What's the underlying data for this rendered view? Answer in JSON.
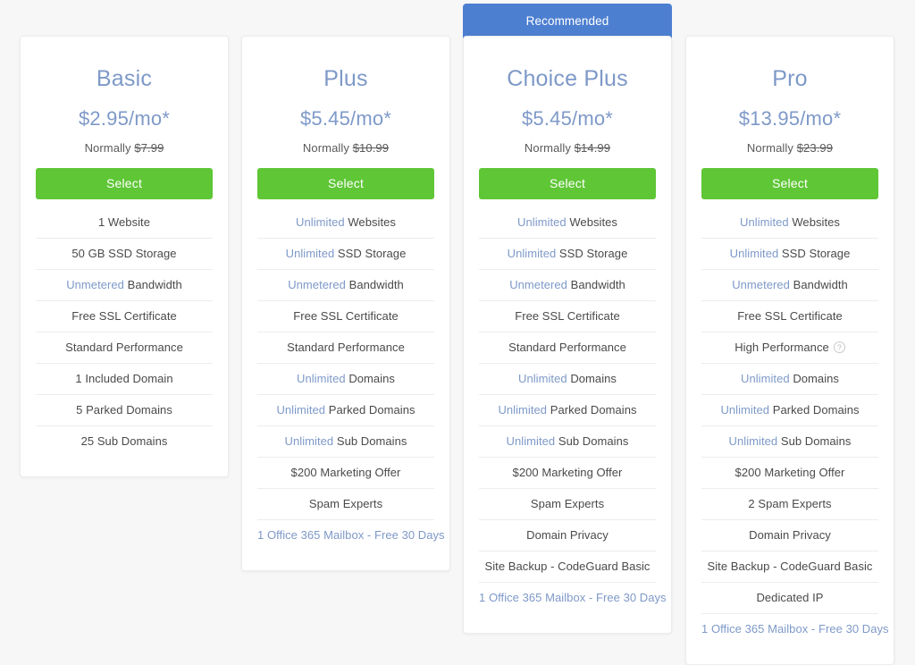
{
  "ribbon": {
    "label": "Recommended",
    "color": "#4d7fd1"
  },
  "theme": {
    "background": "#f7f7f7",
    "card_background": "#ffffff",
    "accent_blue": "#7e99c8",
    "button_green": "#5fc636",
    "divider": "#ededed",
    "text": "#4a4a4a"
  },
  "common": {
    "normally_prefix": "Normally",
    "select_label": "Select",
    "info_icon": "question-circle-icon"
  },
  "plans": [
    {
      "id": "basic",
      "name": "Basic",
      "price": "$2.95/mo*",
      "normally_prefix": "Normally",
      "normally_price": "$7.99",
      "select_label": "Select",
      "recommended": false,
      "features": [
        {
          "highlight": "",
          "text": "1 Website",
          "link": false,
          "info": false
        },
        {
          "highlight": "",
          "text": "50 GB SSD Storage",
          "link": false,
          "info": false
        },
        {
          "highlight": "Unmetered",
          "text": " Bandwidth",
          "link": false,
          "info": false
        },
        {
          "highlight": "",
          "text": "Free SSL Certificate",
          "link": false,
          "info": false
        },
        {
          "highlight": "",
          "text": "Standard Performance",
          "link": false,
          "info": false
        },
        {
          "highlight": "",
          "text": "1 Included Domain",
          "link": false,
          "info": false
        },
        {
          "highlight": "",
          "text": "5 Parked Domains",
          "link": false,
          "info": false
        },
        {
          "highlight": "",
          "text": "25 Sub Domains",
          "link": false,
          "info": false
        }
      ]
    },
    {
      "id": "plus",
      "name": "Plus",
      "price": "$5.45/mo*",
      "normally_prefix": "Normally",
      "normally_price": "$10.99",
      "select_label": "Select",
      "recommended": false,
      "features": [
        {
          "highlight": "Unlimited",
          "text": " Websites",
          "link": false,
          "info": false
        },
        {
          "highlight": "Unlimited",
          "text": " SSD Storage",
          "link": false,
          "info": false
        },
        {
          "highlight": "Unmetered",
          "text": " Bandwidth",
          "link": false,
          "info": false
        },
        {
          "highlight": "",
          "text": "Free SSL Certificate",
          "link": false,
          "info": false
        },
        {
          "highlight": "",
          "text": "Standard Performance",
          "link": false,
          "info": false
        },
        {
          "highlight": "Unlimited",
          "text": " Domains",
          "link": false,
          "info": false
        },
        {
          "highlight": "Unlimited",
          "text": " Parked Domains",
          "link": false,
          "info": false
        },
        {
          "highlight": "Unlimited",
          "text": " Sub Domains",
          "link": false,
          "info": false
        },
        {
          "highlight": "",
          "text": "$200 Marketing Offer",
          "link": false,
          "info": false
        },
        {
          "highlight": "",
          "text": "Spam Experts",
          "link": false,
          "info": false
        },
        {
          "highlight": "",
          "text": "1 Office 365 Mailbox - Free 30 Days",
          "link": true,
          "info": false
        }
      ]
    },
    {
      "id": "choice-plus",
      "name": "Choice Plus",
      "price": "$5.45/mo*",
      "normally_prefix": "Normally",
      "normally_price": "$14.99",
      "select_label": "Select",
      "recommended": true,
      "features": [
        {
          "highlight": "Unlimited",
          "text": " Websites",
          "link": false,
          "info": false
        },
        {
          "highlight": "Unlimited",
          "text": " SSD Storage",
          "link": false,
          "info": false
        },
        {
          "highlight": "Unmetered",
          "text": " Bandwidth",
          "link": false,
          "info": false
        },
        {
          "highlight": "",
          "text": "Free SSL Certificate",
          "link": false,
          "info": false
        },
        {
          "highlight": "",
          "text": "Standard Performance",
          "link": false,
          "info": false
        },
        {
          "highlight": "Unlimited",
          "text": " Domains",
          "link": false,
          "info": false
        },
        {
          "highlight": "Unlimited",
          "text": " Parked Domains",
          "link": false,
          "info": false
        },
        {
          "highlight": "Unlimited",
          "text": " Sub Domains",
          "link": false,
          "info": false
        },
        {
          "highlight": "",
          "text": "$200 Marketing Offer",
          "link": false,
          "info": false
        },
        {
          "highlight": "",
          "text": "Spam Experts",
          "link": false,
          "info": false
        },
        {
          "highlight": "",
          "text": "Domain Privacy",
          "link": false,
          "info": false
        },
        {
          "highlight": "",
          "text": "Site Backup - CodeGuard Basic",
          "link": false,
          "info": false
        },
        {
          "highlight": "",
          "text": "1 Office 365 Mailbox - Free 30 Days",
          "link": true,
          "info": false
        }
      ]
    },
    {
      "id": "pro",
      "name": "Pro",
      "price": "$13.95/mo*",
      "normally_prefix": "Normally",
      "normally_price": "$23.99",
      "select_label": "Select",
      "recommended": false,
      "features": [
        {
          "highlight": "Unlimited",
          "text": " Websites",
          "link": false,
          "info": false
        },
        {
          "highlight": "Unlimited",
          "text": " SSD Storage",
          "link": false,
          "info": false
        },
        {
          "highlight": "Unmetered",
          "text": " Bandwidth",
          "link": false,
          "info": false
        },
        {
          "highlight": "",
          "text": "Free SSL Certificate",
          "link": false,
          "info": false
        },
        {
          "highlight": "",
          "text": "High Performance",
          "link": false,
          "info": true
        },
        {
          "highlight": "Unlimited",
          "text": " Domains",
          "link": false,
          "info": false
        },
        {
          "highlight": "Unlimited",
          "text": " Parked Domains",
          "link": false,
          "info": false
        },
        {
          "highlight": "Unlimited",
          "text": " Sub Domains",
          "link": false,
          "info": false
        },
        {
          "highlight": "",
          "text": "$200 Marketing Offer",
          "link": false,
          "info": false
        },
        {
          "highlight": "",
          "text": "2 Spam Experts",
          "link": false,
          "info": false
        },
        {
          "highlight": "",
          "text": "Domain Privacy",
          "link": false,
          "info": false
        },
        {
          "highlight": "",
          "text": "Site Backup - CodeGuard Basic",
          "link": false,
          "info": false
        },
        {
          "highlight": "",
          "text": "Dedicated IP",
          "link": false,
          "info": false
        },
        {
          "highlight": "",
          "text": "1 Office 365 Mailbox - Free 30 Days",
          "link": true,
          "info": false
        }
      ]
    }
  ]
}
